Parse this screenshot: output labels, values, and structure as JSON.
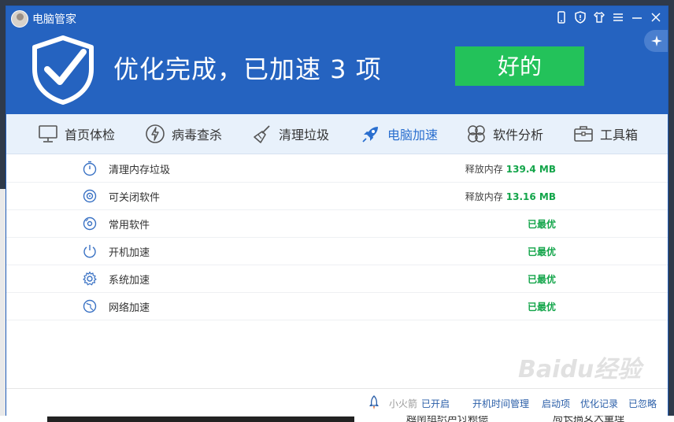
{
  "app": {
    "title": "电脑管家"
  },
  "banner": {
    "message": "优化完成，已加速 3 项",
    "ok_label": "好的"
  },
  "nav": [
    {
      "label": "首页体检",
      "icon": "monitor-icon"
    },
    {
      "label": "病毒查杀",
      "icon": "lightning-icon"
    },
    {
      "label": "清理垃圾",
      "icon": "broom-icon"
    },
    {
      "label": "电脑加速",
      "icon": "rocket-icon",
      "active": true
    },
    {
      "label": "软件分析",
      "icon": "clover-icon"
    },
    {
      "label": "工具箱",
      "icon": "toolbox-icon"
    }
  ],
  "rows": [
    {
      "label": "清理内存垃圾",
      "status_prefix": "释放内存",
      "status_value": "139.4 MB",
      "icon": "timer-icon"
    },
    {
      "label": "可关闭软件",
      "status_prefix": "释放内存",
      "status_value": "13.16 MB",
      "icon": "disc-icon"
    },
    {
      "label": "常用软件",
      "status_prefix": "",
      "status_value": "已最优",
      "icon": "cd-icon"
    },
    {
      "label": "开机加速",
      "status_prefix": "",
      "status_value": "已最优",
      "icon": "power-icon"
    },
    {
      "label": "系统加速",
      "status_prefix": "",
      "status_value": "已最优",
      "icon": "gear-icon"
    },
    {
      "label": "网络加速",
      "status_prefix": "",
      "status_value": "已最优",
      "icon": "globe-icon"
    }
  ],
  "footer": {
    "rocket_label": "小火箭",
    "rocket_status": "已开启",
    "boot_time": "开机时间管理",
    "startup_items": "启动项",
    "history": "优化记录",
    "ignored": "已忽略"
  },
  "watermark": {
    "text": "Baidu经验"
  },
  "background": {
    "text1": "越南组织声讨赖德",
    "text2": "局长搞女大量理"
  },
  "colors": {
    "header": "#2563c0",
    "ok_button": "#23c25a",
    "accent_green": "#13a54a",
    "link_blue": "#2a5ea8"
  }
}
